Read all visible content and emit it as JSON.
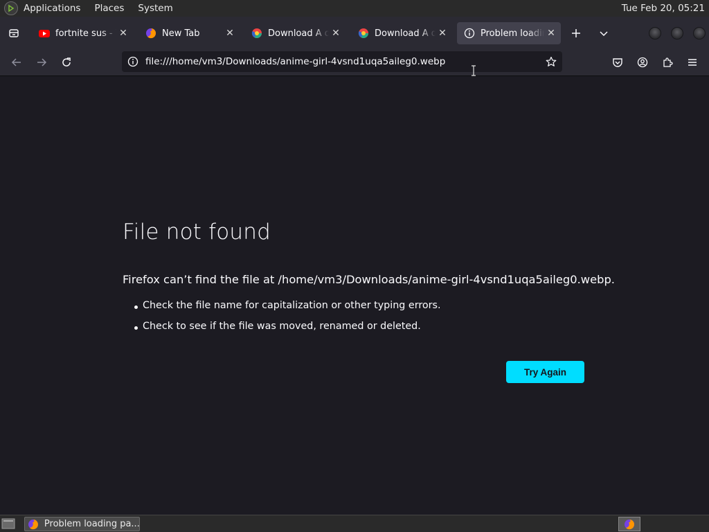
{
  "system_panel": {
    "menus": [
      "Applications",
      "Places",
      "System"
    ],
    "clock": "Tue Feb 20, 05:21"
  },
  "tabs": [
    {
      "title": "fortnite sus - YouTube",
      "favicon": "youtube-icon",
      "active": false
    },
    {
      "title": "New Tab",
      "favicon": "firefox-icon",
      "active": false
    },
    {
      "title": "Download A dream",
      "favicon": "chrome-like-icon",
      "active": false
    },
    {
      "title": "Download A dream",
      "favicon": "chrome-like-icon",
      "active": false
    },
    {
      "title": "Problem loading page",
      "favicon": "info-icon",
      "active": true
    }
  ],
  "urlbar": {
    "url": "file:///home/vm3/Downloads/anime-girl-4vsnd1uqa5aileg0.webp"
  },
  "error_page": {
    "title": "File not found",
    "description": "Firefox can’t find the file at /home/vm3/Downloads/anime-girl-4vsnd1uqa5aileg0.webp.",
    "suggestions": [
      "Check the file name for capitalization or other typing errors.",
      "Check to see if the file was moved, renamed or deleted."
    ],
    "button_label": "Try Again",
    "button_color": "#00ddff"
  },
  "taskbar": {
    "window_label": "Problem loading pa..."
  }
}
